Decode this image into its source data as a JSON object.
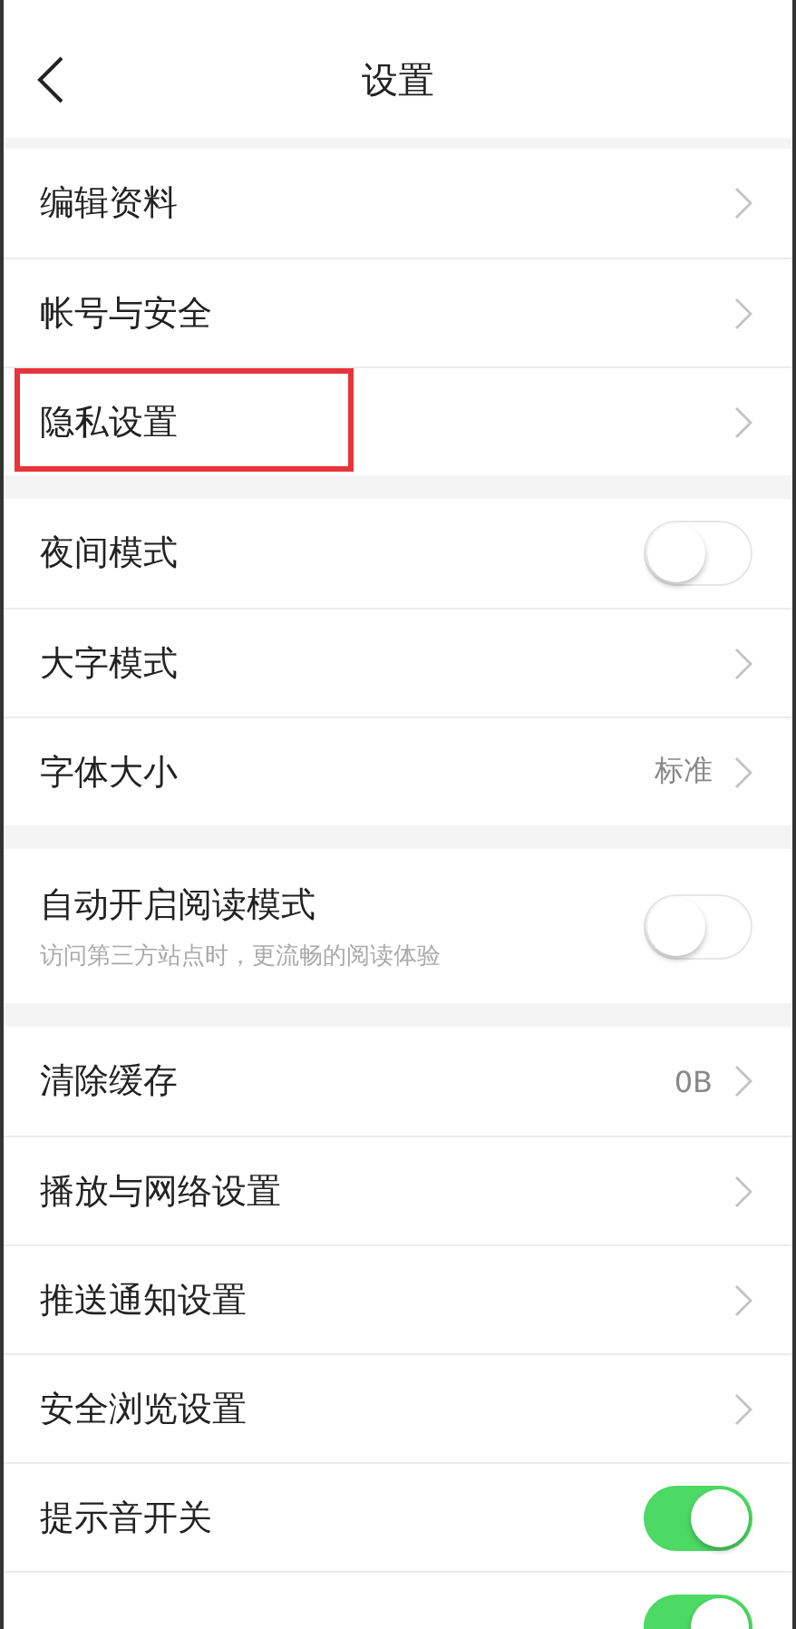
{
  "nav": {
    "title": "设置"
  },
  "groups": [
    {
      "items": [
        {
          "kind": "link",
          "label": "编辑资料",
          "highlighted": false
        },
        {
          "kind": "link",
          "label": "帐号与安全",
          "highlighted": false
        },
        {
          "kind": "link",
          "label": "隐私设置",
          "highlighted": true
        }
      ]
    },
    {
      "items": [
        {
          "kind": "toggle",
          "label": "夜间模式",
          "on": false
        },
        {
          "kind": "link",
          "label": "大字模式",
          "highlighted": false
        },
        {
          "kind": "link",
          "label": "字体大小",
          "value": "标准",
          "highlighted": false
        }
      ]
    },
    {
      "items": [
        {
          "kind": "toggle",
          "label": "自动开启阅读模式",
          "hint": "访问第三方站点时，更流畅的阅读体验",
          "on": false
        }
      ]
    },
    {
      "items": [
        {
          "kind": "link",
          "label": "清除缓存",
          "value": "0B",
          "highlighted": false
        },
        {
          "kind": "link",
          "label": "播放与网络设置",
          "highlighted": false
        },
        {
          "kind": "link",
          "label": "推送通知设置",
          "highlighted": false
        },
        {
          "kind": "link",
          "label": "安全浏览设置",
          "highlighted": false
        },
        {
          "kind": "toggle",
          "label": "提示音开关",
          "on": true
        },
        {
          "kind": "toggle",
          "on": true
        }
      ]
    }
  ]
}
